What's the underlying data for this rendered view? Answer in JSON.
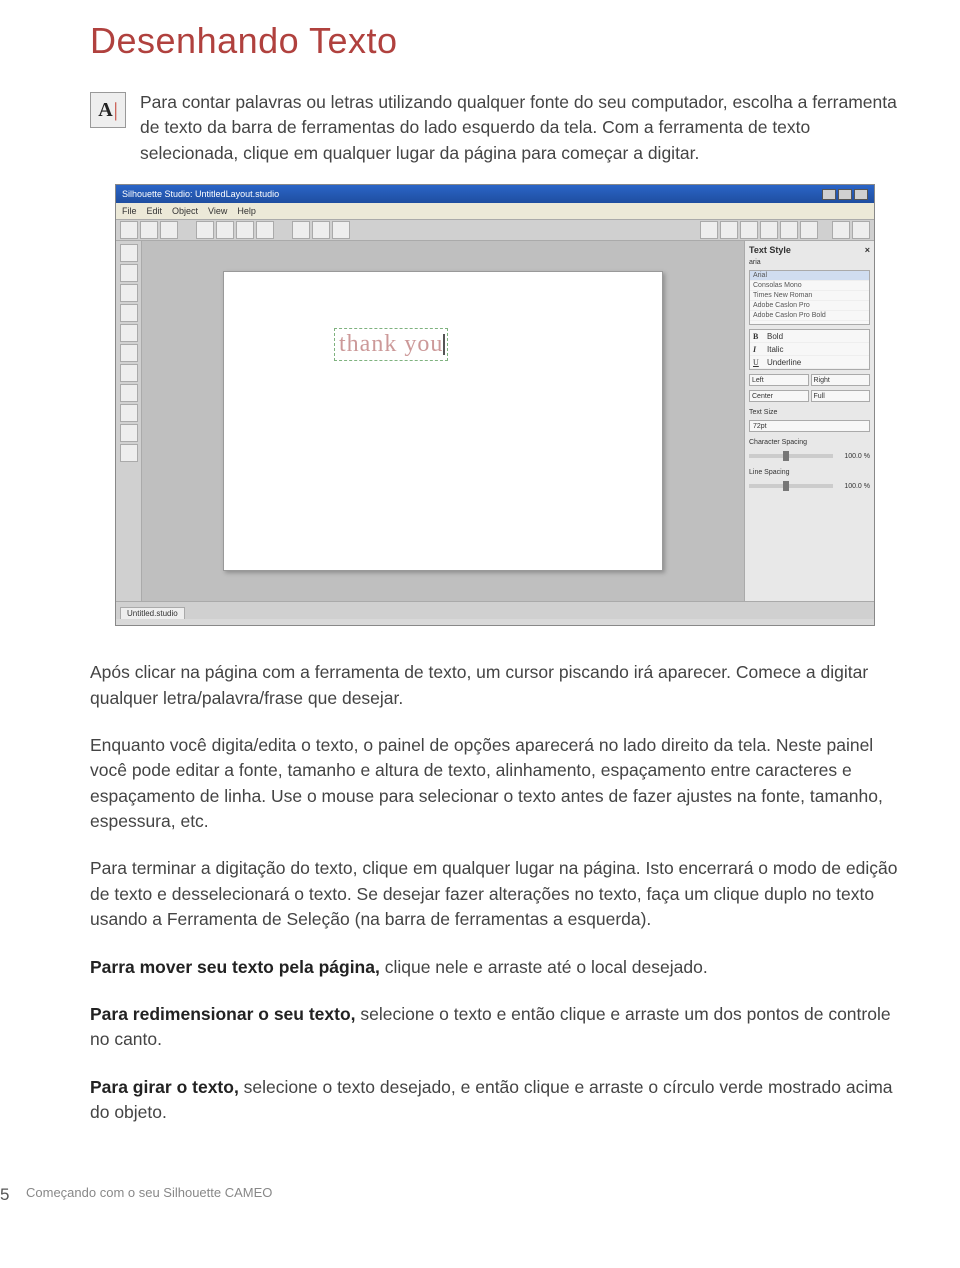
{
  "title": "Desenhando Texto",
  "intro": "Para contar palavras ou letras utilizando qualquer fonte do seu computador, escolha a ferramenta de texto da barra de ferramentas do lado esquerdo da tela. Com a ferramenta de texto selecionada, clique em qualquer lugar da página para começar a digitar.",
  "para_cursor": "Após clicar na página com a ferramenta de texto, um cursor piscando irá aparecer. Comece a digitar qualquer letra/palavra/frase que desejar.",
  "para_panel": "Enquanto você digita/edita o texto, o painel de opções aparecerá no lado direito da tela. Neste painel você pode editar a fonte, tamanho e altura de texto, alinhamento, espaçamento entre caracteres e espaçamento de linha. Use o mouse para selecionar o texto antes de fazer ajustes na fonte, tamanho, espessura, etc.",
  "para_end_edit": "Para terminar a digitação do texto, clique em qualquer lugar na página. Isto encerrará o modo de edição de texto e desselecionará o texto. Se desejar fazer alterações no texto, faça um clique duplo no texto usando a Ferramenta de Seleção (na barra de ferramentas a esquerda).",
  "move": {
    "lead": "Parra mover seu texto pela página,",
    "rest": " clique nele e arraste até o local desejado."
  },
  "resize": {
    "lead": "Para redimensionar o seu texto,",
    "rest": " selecione o texto e então clique e arraste um dos pontos de controle no canto."
  },
  "rotate": {
    "lead": "Para girar o texto,",
    "rest": " selecione o texto desejado, e então clique e arraste o círculo verde mostrado acima do objeto."
  },
  "screenshot": {
    "window_title": "Silhouette Studio: UntitledLayout.studio",
    "menus": [
      "File",
      "Edit",
      "Object",
      "View",
      "Help"
    ],
    "tab_label": "Untitled.studio",
    "canvas_text": "thank you",
    "panel": {
      "title": "Text Style",
      "close_glyph": "×",
      "search_label": "aria",
      "fonts": [
        "Arial",
        "Consolas Mono",
        "Times New Roman",
        "Adobe Caslon Pro",
        "Adobe Caslon Pro Bold"
      ],
      "selected_font_index": 0,
      "styles": [
        {
          "glyph": "B",
          "label": "Bold"
        },
        {
          "glyph": "I",
          "label": "Italic"
        },
        {
          "glyph": "U",
          "label": "Underline"
        }
      ],
      "align": {
        "left": "Left",
        "center": "Center",
        "right": "Right",
        "full": "Full"
      },
      "text_size": {
        "label": "Text Size",
        "value": "72pt"
      },
      "char_spacing": {
        "label": "Character Spacing",
        "value": "100.0 %"
      },
      "line_spacing": {
        "label": "Line Spacing",
        "value": "100.0 %"
      }
    }
  },
  "footer": {
    "page_number": "5",
    "label": "Começando com o seu Silhouette CAMEO"
  }
}
